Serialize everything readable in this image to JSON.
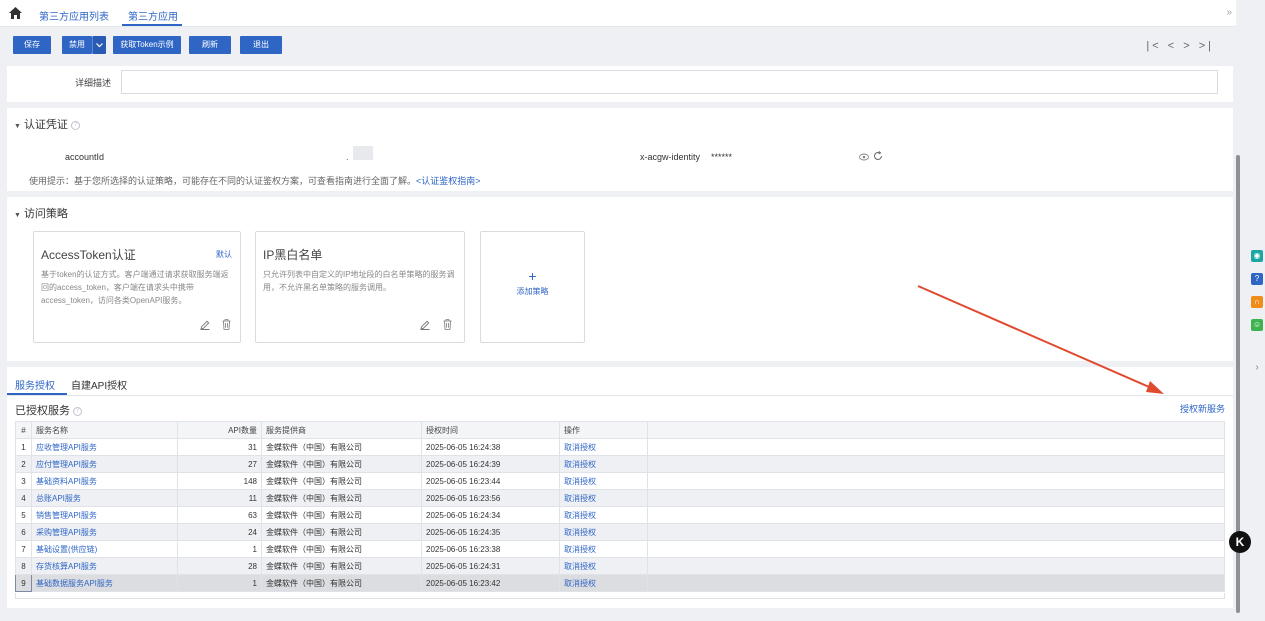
{
  "tabs": [
    "第三方应用列表",
    "第三方应用"
  ],
  "toolbar": {
    "save": "保存",
    "disable": "禁用",
    "token_example": "获取Token示例",
    "refresh": "刷新",
    "exit": "退出",
    "pager": "|< < > >|"
  },
  "description": {
    "label": "详细描述",
    "value": ""
  },
  "auth": {
    "title": "认证凭证",
    "account_label": "accountId",
    "account_value": ".",
    "identity_label": "x-acgw-identity",
    "identity_value": "******",
    "tip": "使用提示：基于您所选择的认证策略，可能存在不同的认证鉴权方案，可查看指南进行全面了解。",
    "tip_link": "<认证鉴权指南>"
  },
  "policy": {
    "title": "访问策略",
    "cards": [
      {
        "title": "AccessToken认证",
        "badge": "默认",
        "desc": "基于token的认证方式。客户端通过请求获取服务端返回的access_token，客户端在请求头中携带access_token，访问各类OpenAPI服务。"
      },
      {
        "title": "IP黑白名单",
        "badge": "",
        "desc": "只允许列表中自定义的IP地址段的白名单策略的服务调用，不允许黑名单策略的服务调用。"
      }
    ],
    "add_label": "添加策略"
  },
  "services": {
    "tabs": [
      "服务授权",
      "自建API授权"
    ],
    "title": "已授权服务",
    "grant_link": "授权新服务",
    "columns": [
      "#",
      "服务名称",
      "API数量",
      "服务提供商",
      "授权时间",
      "操作"
    ],
    "rows": [
      {
        "idx": "1",
        "name": "应收管理API服务",
        "count": "31",
        "provider": "金蝶软件（中国）有限公司",
        "time": "2025-06-05 16:24:38",
        "action": "取消授权"
      },
      {
        "idx": "2",
        "name": "应付管理API服务",
        "count": "27",
        "provider": "金蝶软件（中国）有限公司",
        "time": "2025-06-05 16:24:39",
        "action": "取消授权"
      },
      {
        "idx": "3",
        "name": "基础资料API服务",
        "count": "148",
        "provider": "金蝶软件（中国）有限公司",
        "time": "2025-06-05 16:23:44",
        "action": "取消授权"
      },
      {
        "idx": "4",
        "name": "总账API服务",
        "count": "11",
        "provider": "金蝶软件（中国）有限公司",
        "time": "2025-06-05 16:23:56",
        "action": "取消授权"
      },
      {
        "idx": "5",
        "name": "销售管理API服务",
        "count": "63",
        "provider": "金蝶软件（中国）有限公司",
        "time": "2025-06-05 16:24:34",
        "action": "取消授权"
      },
      {
        "idx": "6",
        "name": "采购管理API服务",
        "count": "24",
        "provider": "金蝶软件（中国）有限公司",
        "time": "2025-06-05 16:24:35",
        "action": "取消授权"
      },
      {
        "idx": "7",
        "name": "基础设置(供应链)",
        "count": "1",
        "provider": "金蝶软件（中国）有限公司",
        "time": "2025-06-05 16:23:38",
        "action": "取消授权"
      },
      {
        "idx": "8",
        "name": "存货核算API服务",
        "count": "28",
        "provider": "金蝶软件（中国）有限公司",
        "time": "2025-06-05 16:24:31",
        "action": "取消授权"
      },
      {
        "idx": "9",
        "name": "基础数据服务API服务",
        "count": "1",
        "provider": "金蝶软件（中国）有限公司",
        "time": "2025-06-05 16:23:42",
        "action": "取消授权"
      }
    ]
  },
  "colors": {
    "accent": "#2f66c6",
    "arrow": "#e04a2f",
    "float_icons": [
      "#1aa6a1",
      "#2f66c6",
      "#f08c1a",
      "#3fb34f"
    ]
  },
  "icons": [
    "home-icon",
    "collapse-icon",
    "help-icon",
    "eye-icon",
    "refresh-icon",
    "edit-icon",
    "delete-icon",
    "plus-icon",
    "chevron-down-icon"
  ]
}
